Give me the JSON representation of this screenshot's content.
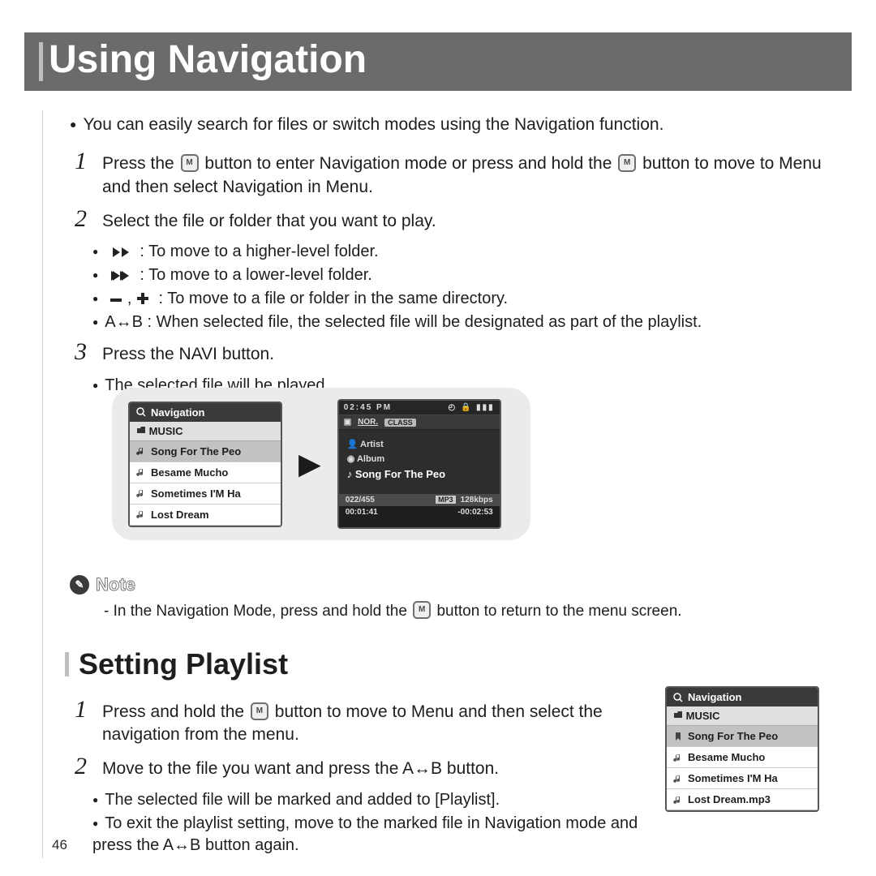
{
  "page_title": "Using Navigation",
  "page_number": "46",
  "intro": "You can easily search for files or switch modes using the Navigation function.",
  "steps": {
    "s1a": "Press the ",
    "s1b": " button to enter Navigation mode or press and hold the ",
    "s1c": " button to move to Menu and then select Navigation in Menu.",
    "s2": "Select the file or folder that you want to play.",
    "s2_sub": {
      "a": ": To move to a higher-level folder.",
      "b": ": To move to a lower-level folder.",
      "c": ": To move to a file or folder in the same directory.",
      "d": "A↔B : When selected file, the selected file will be designated as part of the playlist."
    },
    "s3": "Press the NAVI button.",
    "s3_sub": "The selected file will be played."
  },
  "note": {
    "label": "Note",
    "t1": "- In the Navigation Mode, press and hold the ",
    "t2": " button to return to the menu screen."
  },
  "section2_title": "Setting Playlist",
  "playlist": {
    "p1a": "Press and hold the ",
    "p1b": " button to move to Menu and then select the navigation from the menu.",
    "p2": "Move to the file you want and press the A↔B button.",
    "p2_sub1": "The selected file will be marked and added to [Playlist].",
    "p2_sub2": "To exit the playlist setting, move to the marked file in Navigation mode and press the A↔B button again."
  },
  "nav_screen": {
    "title": "Navigation",
    "folder": "MUSIC",
    "rows": [
      "Song For The Peo",
      "Besame Mucho",
      "Sometimes I'M Ha",
      "Lost Dream"
    ]
  },
  "nav_screen2": {
    "rows": [
      "Song For The Peo",
      "Besame Mucho",
      "Sometimes I'M Ha",
      "Lost Dream.mp3"
    ]
  },
  "play_screen": {
    "time": "02:45 PM",
    "mode1": "NOR.",
    "mode2": "CLASS",
    "artist": "Artist",
    "album": "Album",
    "track": "Song For The Peo",
    "count": "022/455",
    "fmt": "MP3",
    "rate": "128kbps",
    "elapsed": "00:01:41",
    "remain": "-00:02:53"
  }
}
